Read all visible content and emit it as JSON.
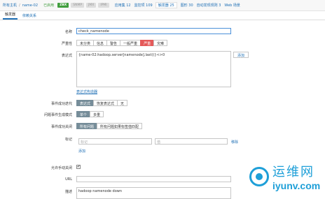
{
  "breadcrumb": {
    "all_hosts": "所有主机",
    "sep": "/",
    "host": "name-02"
  },
  "status": "已启用",
  "availability": [
    "ZBX",
    "SNMP",
    "JMX",
    "IPMI"
  ],
  "nav": {
    "apps": "应用集 12",
    "items": "监控项 109",
    "triggers": "触发器 25",
    "graphs": "图形 30",
    "discovery": "自动发现规则 3",
    "web": "Web 场景"
  },
  "tabs": {
    "trigger": "触发器",
    "deps": "依赖关系"
  },
  "form": {
    "name": {
      "label": "名称",
      "value": "check_namenode"
    },
    "severity": {
      "label": "严重性",
      "options": [
        "未分类",
        "信息",
        "警告",
        "一般严重",
        "严重",
        "灾难"
      ]
    },
    "expression": {
      "label": "表达式",
      "value": "{name-02:hadoop.server[namenode].last()}<>0",
      "add": "添加",
      "constructor": "表达式构造器"
    },
    "ok_event": {
      "label": "事件成功迭代",
      "options": [
        "表达式",
        "恢复表达式",
        "无"
      ]
    },
    "gen_mode": {
      "label": "问题事件生成模式",
      "options": [
        "单个",
        "多重"
      ]
    },
    "ok_close": {
      "label": "事件成功关闭",
      "options": [
        "所有问题",
        "所有问题如果标签值匹配"
      ]
    },
    "tags": {
      "label": "标记",
      "tag_ph": "标记",
      "value_ph": "值",
      "remove": "移除",
      "add": "添加"
    },
    "manual_close": {
      "label": "允许手动关闭",
      "mark": "✔"
    },
    "url": {
      "label": "URL",
      "value": ""
    },
    "desc": {
      "label": "描述",
      "value": "hadoop namenode down"
    }
  },
  "watermark": {
    "main": "运维网",
    "sub": "iyunv.com"
  },
  "colors": {
    "link": "#1e6fb5",
    "selected": "#768d99",
    "severity_high": "#e45959",
    "zbx": "#419e3e",
    "watermark": "#1e9fd8"
  }
}
